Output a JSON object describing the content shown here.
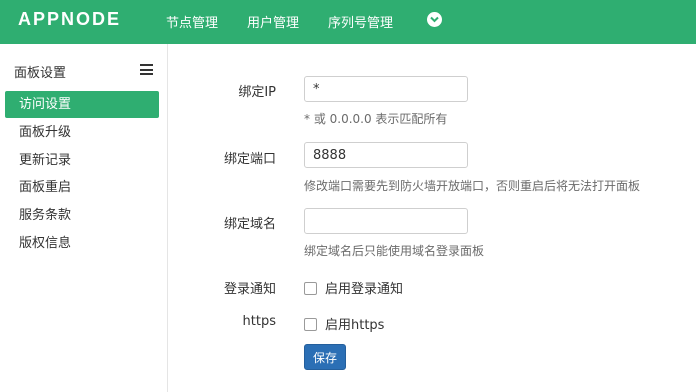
{
  "topbar": {
    "logo": "APPNODE",
    "nav": [
      "节点管理",
      "用户管理",
      "序列号管理"
    ]
  },
  "sidebar": {
    "title": "面板设置",
    "items": [
      {
        "label": "访问设置",
        "active": true
      },
      {
        "label": "面板升级"
      },
      {
        "label": "更新记录"
      },
      {
        "label": "面板重启"
      },
      {
        "label": "服务条款"
      },
      {
        "label": "版权信息"
      }
    ]
  },
  "form": {
    "bind_ip": {
      "label": "绑定IP",
      "value": "*",
      "help": "* 或 0.0.0.0 表示匹配所有"
    },
    "bind_port": {
      "label": "绑定端口",
      "value": "8888",
      "help": "修改端口需要先到防火墙开放端口，否则重启后将无法打开面板"
    },
    "bind_domain": {
      "label": "绑定域名",
      "value": "",
      "help": "绑定域名后只能使用域名登录面板"
    },
    "login_notify": {
      "label": "登录通知",
      "checkbox_label": "启用登录通知",
      "checked": false
    },
    "https": {
      "label": "https",
      "checkbox_label": "启用https",
      "checked": false
    },
    "save_label": "保存"
  },
  "colors": {
    "brand": "#2fae71",
    "primary_button": "#2b6fb5"
  }
}
